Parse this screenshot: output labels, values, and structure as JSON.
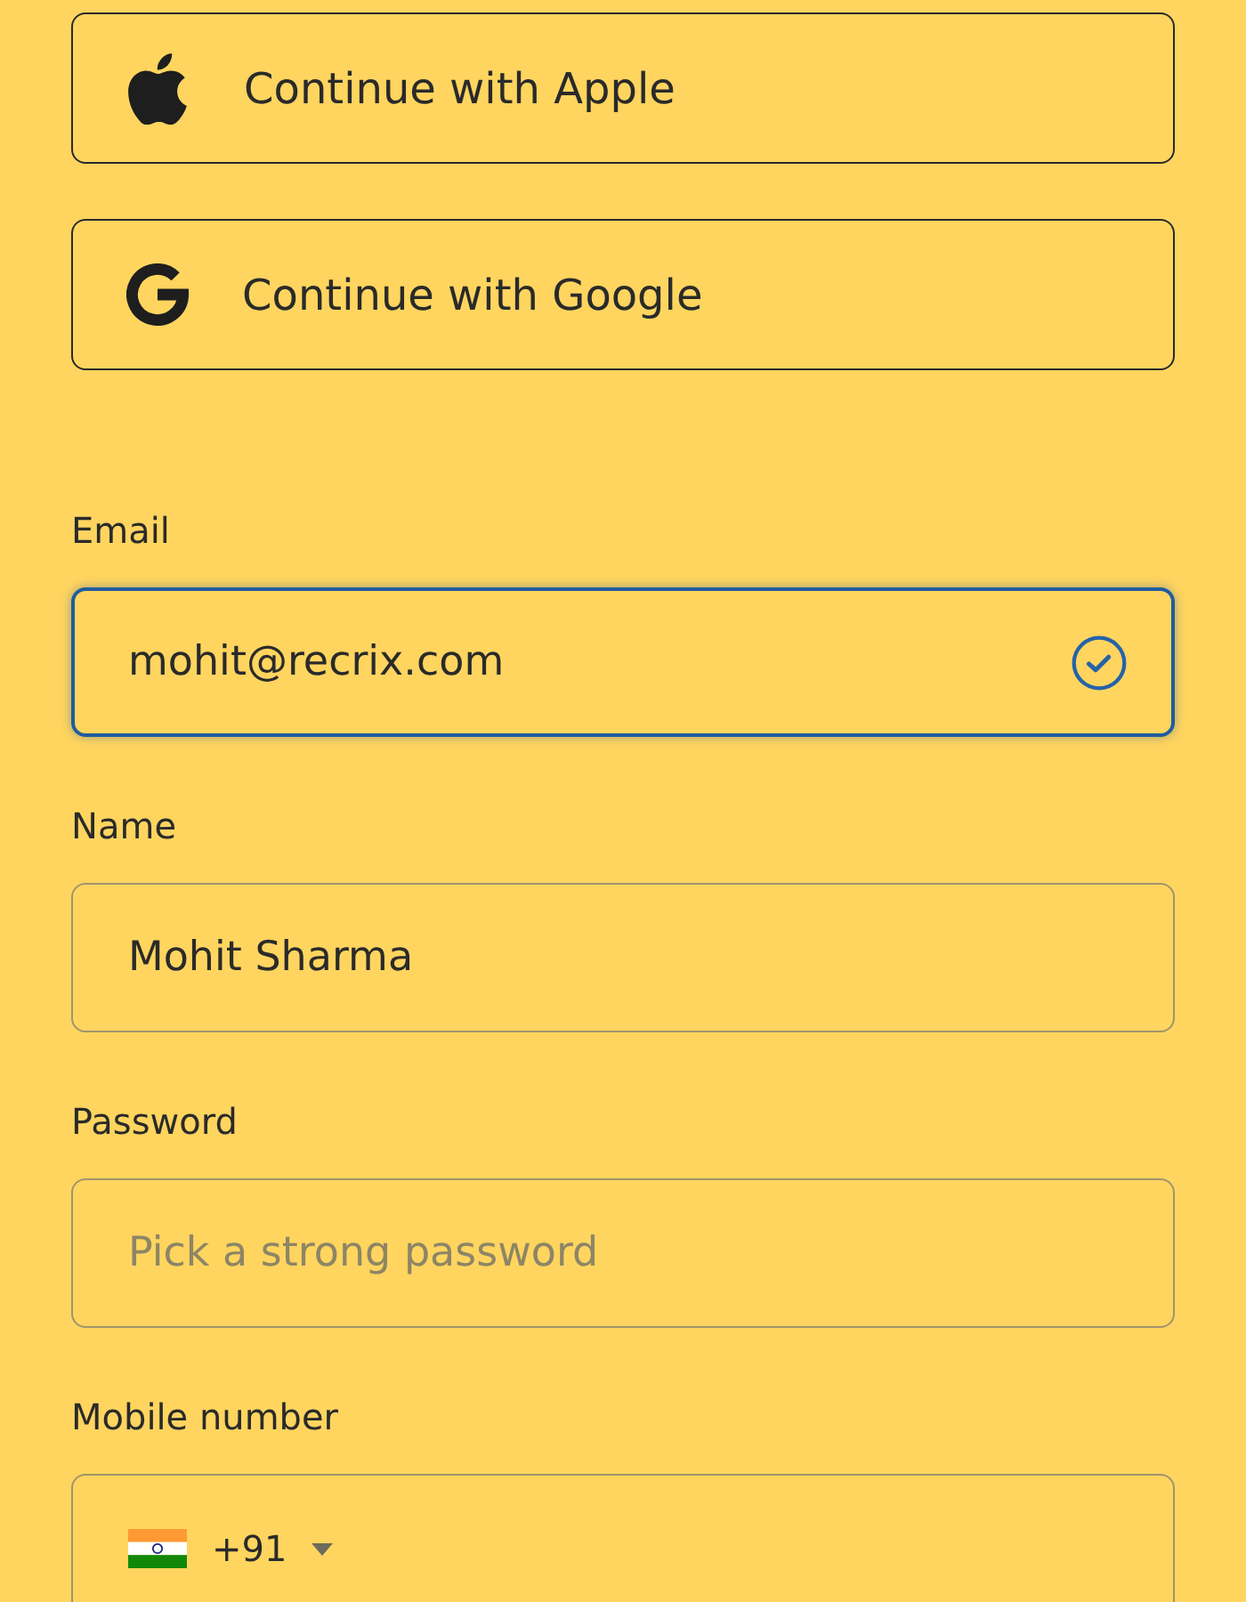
{
  "social_buttons": [
    {
      "kind": "apple",
      "label": "Continue with Apple"
    },
    {
      "kind": "google",
      "label": "Continue with Google"
    }
  ],
  "fields": [
    {
      "kind": "email",
      "label": "Email",
      "value": "mohit@recrix.com",
      "focused": true,
      "verified": true
    },
    {
      "kind": "name",
      "label": "Name",
      "value": "Mohit Sharma",
      "focused": false,
      "verified": false
    },
    {
      "kind": "password",
      "label": "Password",
      "placeholder": "Pick a strong password",
      "focused": false,
      "verified": false
    },
    {
      "kind": "phone",
      "label": "Mobile number",
      "country_code": "+91",
      "focused": false,
      "verified": false
    }
  ]
}
